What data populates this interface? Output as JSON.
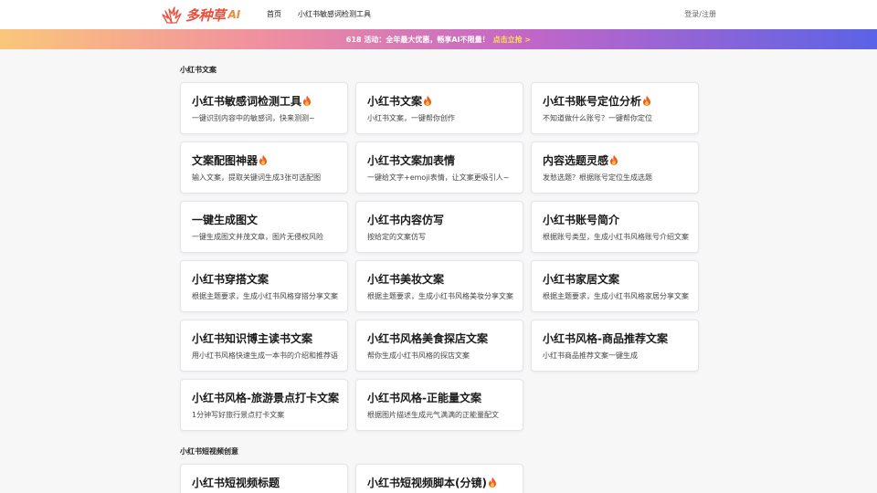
{
  "header": {
    "logo_text": "多种草",
    "logo_ai": "AI",
    "nav": [
      "首页",
      "小红书敏感词检测工具"
    ],
    "login": "登录/注册"
  },
  "promo": {
    "text": "618 活动：全年最大优惠，畅享AI不限量！",
    "cta": "点击立抢 >"
  },
  "sections": [
    {
      "title": "小红书文案",
      "cards": [
        {
          "title": "小红书敏感词检测工具",
          "hot": true,
          "desc": "一键识别内容中的敏感词，快来测测~"
        },
        {
          "title": "小红书文案",
          "hot": true,
          "desc": "小红书文案，一键帮你创作"
        },
        {
          "title": "小红书账号定位分析",
          "hot": true,
          "desc": "不知道做什么账号？一键帮你定位"
        },
        {
          "title": "文案配图神器",
          "hot": true,
          "desc": "输入文案，提取关键词生成3张可选配图"
        },
        {
          "title": "小红书文案加表情",
          "hot": false,
          "desc": "一键给文字+emoji表情，让文案更吸引人~"
        },
        {
          "title": "内容选题灵感",
          "hot": true,
          "desc": "发愁选题？根据账号定位生成选题"
        },
        {
          "title": "一键生成图文",
          "hot": false,
          "desc": "一键生成图文并茂文章，图片无侵权风险"
        },
        {
          "title": "小红书内容仿写",
          "hot": false,
          "desc": "按给定的文案仿写"
        },
        {
          "title": "小红书账号简介",
          "hot": false,
          "desc": "根据账号类型，生成小红书风格账号介绍文案"
        },
        {
          "title": "小红书穿搭文案",
          "hot": false,
          "desc": "根据主题要求，生成小红书风格穿搭分享文案"
        },
        {
          "title": "小红书美妆文案",
          "hot": false,
          "desc": "根据主题要求，生成小红书风格美妆分享文案"
        },
        {
          "title": "小红书家居文案",
          "hot": false,
          "desc": "根据主题要求，生成小红书风格家居分享文案"
        },
        {
          "title": "小红书知识博主读书文案",
          "hot": false,
          "desc": "用小红书风格快速生成一本书的介绍和推荐语"
        },
        {
          "title": "小红书风格美食探店文案",
          "hot": false,
          "desc": "帮你生成小红书风格的探店文案"
        },
        {
          "title": "小红书风格-商品推荐文案",
          "hot": false,
          "desc": "小红书商品推荐文案一键生成"
        },
        {
          "title": "小红书风格-旅游景点打卡文案",
          "hot": false,
          "desc": "1分钟写好旅行景点打卡文案"
        },
        {
          "title": "小红书风格-正能量文案",
          "hot": false,
          "desc": "根据图片描述生成元气满满的正能量配文"
        }
      ]
    },
    {
      "title": "小红书短视频创意",
      "cards": [
        {
          "title": "小红书短视频标题",
          "hot": false,
          "desc": ""
        },
        {
          "title": "小红书短视频脚本(分镜)",
          "hot": true,
          "desc": ""
        }
      ]
    }
  ],
  "colors": {
    "brand": "#ee4d3c",
    "cta": "#ffe14d"
  },
  "icons": {
    "logo": "grass-leaf-icon",
    "hot": "fire-icon"
  }
}
